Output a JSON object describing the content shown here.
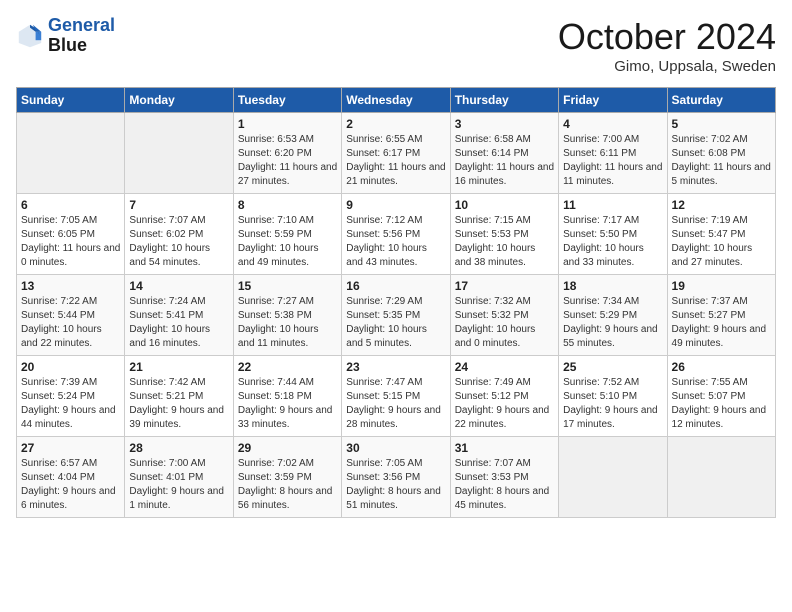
{
  "header": {
    "logo_line1": "General",
    "logo_line2": "Blue",
    "month": "October 2024",
    "location": "Gimo, Uppsala, Sweden"
  },
  "weekdays": [
    "Sunday",
    "Monday",
    "Tuesday",
    "Wednesday",
    "Thursday",
    "Friday",
    "Saturday"
  ],
  "rows": [
    [
      {
        "day": "",
        "empty": true
      },
      {
        "day": "",
        "empty": true
      },
      {
        "day": "1",
        "sunrise": "Sunrise: 6:53 AM",
        "sunset": "Sunset: 6:20 PM",
        "daylight": "Daylight: 11 hours and 27 minutes."
      },
      {
        "day": "2",
        "sunrise": "Sunrise: 6:55 AM",
        "sunset": "Sunset: 6:17 PM",
        "daylight": "Daylight: 11 hours and 21 minutes."
      },
      {
        "day": "3",
        "sunrise": "Sunrise: 6:58 AM",
        "sunset": "Sunset: 6:14 PM",
        "daylight": "Daylight: 11 hours and 16 minutes."
      },
      {
        "day": "4",
        "sunrise": "Sunrise: 7:00 AM",
        "sunset": "Sunset: 6:11 PM",
        "daylight": "Daylight: 11 hours and 11 minutes."
      },
      {
        "day": "5",
        "sunrise": "Sunrise: 7:02 AM",
        "sunset": "Sunset: 6:08 PM",
        "daylight": "Daylight: 11 hours and 5 minutes."
      }
    ],
    [
      {
        "day": "6",
        "sunrise": "Sunrise: 7:05 AM",
        "sunset": "Sunset: 6:05 PM",
        "daylight": "Daylight: 11 hours and 0 minutes."
      },
      {
        "day": "7",
        "sunrise": "Sunrise: 7:07 AM",
        "sunset": "Sunset: 6:02 PM",
        "daylight": "Daylight: 10 hours and 54 minutes."
      },
      {
        "day": "8",
        "sunrise": "Sunrise: 7:10 AM",
        "sunset": "Sunset: 5:59 PM",
        "daylight": "Daylight: 10 hours and 49 minutes."
      },
      {
        "day": "9",
        "sunrise": "Sunrise: 7:12 AM",
        "sunset": "Sunset: 5:56 PM",
        "daylight": "Daylight: 10 hours and 43 minutes."
      },
      {
        "day": "10",
        "sunrise": "Sunrise: 7:15 AM",
        "sunset": "Sunset: 5:53 PM",
        "daylight": "Daylight: 10 hours and 38 minutes."
      },
      {
        "day": "11",
        "sunrise": "Sunrise: 7:17 AM",
        "sunset": "Sunset: 5:50 PM",
        "daylight": "Daylight: 10 hours and 33 minutes."
      },
      {
        "day": "12",
        "sunrise": "Sunrise: 7:19 AM",
        "sunset": "Sunset: 5:47 PM",
        "daylight": "Daylight: 10 hours and 27 minutes."
      }
    ],
    [
      {
        "day": "13",
        "sunrise": "Sunrise: 7:22 AM",
        "sunset": "Sunset: 5:44 PM",
        "daylight": "Daylight: 10 hours and 22 minutes."
      },
      {
        "day": "14",
        "sunrise": "Sunrise: 7:24 AM",
        "sunset": "Sunset: 5:41 PM",
        "daylight": "Daylight: 10 hours and 16 minutes."
      },
      {
        "day": "15",
        "sunrise": "Sunrise: 7:27 AM",
        "sunset": "Sunset: 5:38 PM",
        "daylight": "Daylight: 10 hours and 11 minutes."
      },
      {
        "day": "16",
        "sunrise": "Sunrise: 7:29 AM",
        "sunset": "Sunset: 5:35 PM",
        "daylight": "Daylight: 10 hours and 5 minutes."
      },
      {
        "day": "17",
        "sunrise": "Sunrise: 7:32 AM",
        "sunset": "Sunset: 5:32 PM",
        "daylight": "Daylight: 10 hours and 0 minutes."
      },
      {
        "day": "18",
        "sunrise": "Sunrise: 7:34 AM",
        "sunset": "Sunset: 5:29 PM",
        "daylight": "Daylight: 9 hours and 55 minutes."
      },
      {
        "day": "19",
        "sunrise": "Sunrise: 7:37 AM",
        "sunset": "Sunset: 5:27 PM",
        "daylight": "Daylight: 9 hours and 49 minutes."
      }
    ],
    [
      {
        "day": "20",
        "sunrise": "Sunrise: 7:39 AM",
        "sunset": "Sunset: 5:24 PM",
        "daylight": "Daylight: 9 hours and 44 minutes."
      },
      {
        "day": "21",
        "sunrise": "Sunrise: 7:42 AM",
        "sunset": "Sunset: 5:21 PM",
        "daylight": "Daylight: 9 hours and 39 minutes."
      },
      {
        "day": "22",
        "sunrise": "Sunrise: 7:44 AM",
        "sunset": "Sunset: 5:18 PM",
        "daylight": "Daylight: 9 hours and 33 minutes."
      },
      {
        "day": "23",
        "sunrise": "Sunrise: 7:47 AM",
        "sunset": "Sunset: 5:15 PM",
        "daylight": "Daylight: 9 hours and 28 minutes."
      },
      {
        "day": "24",
        "sunrise": "Sunrise: 7:49 AM",
        "sunset": "Sunset: 5:12 PM",
        "daylight": "Daylight: 9 hours and 22 minutes."
      },
      {
        "day": "25",
        "sunrise": "Sunrise: 7:52 AM",
        "sunset": "Sunset: 5:10 PM",
        "daylight": "Daylight: 9 hours and 17 minutes."
      },
      {
        "day": "26",
        "sunrise": "Sunrise: 7:55 AM",
        "sunset": "Sunset: 5:07 PM",
        "daylight": "Daylight: 9 hours and 12 minutes."
      }
    ],
    [
      {
        "day": "27",
        "sunrise": "Sunrise: 6:57 AM",
        "sunset": "Sunset: 4:04 PM",
        "daylight": "Daylight: 9 hours and 6 minutes."
      },
      {
        "day": "28",
        "sunrise": "Sunrise: 7:00 AM",
        "sunset": "Sunset: 4:01 PM",
        "daylight": "Daylight: 9 hours and 1 minute."
      },
      {
        "day": "29",
        "sunrise": "Sunrise: 7:02 AM",
        "sunset": "Sunset: 3:59 PM",
        "daylight": "Daylight: 8 hours and 56 minutes."
      },
      {
        "day": "30",
        "sunrise": "Sunrise: 7:05 AM",
        "sunset": "Sunset: 3:56 PM",
        "daylight": "Daylight: 8 hours and 51 minutes."
      },
      {
        "day": "31",
        "sunrise": "Sunrise: 7:07 AM",
        "sunset": "Sunset: 3:53 PM",
        "daylight": "Daylight: 8 hours and 45 minutes."
      },
      {
        "day": "",
        "empty": true
      },
      {
        "day": "",
        "empty": true
      }
    ]
  ]
}
